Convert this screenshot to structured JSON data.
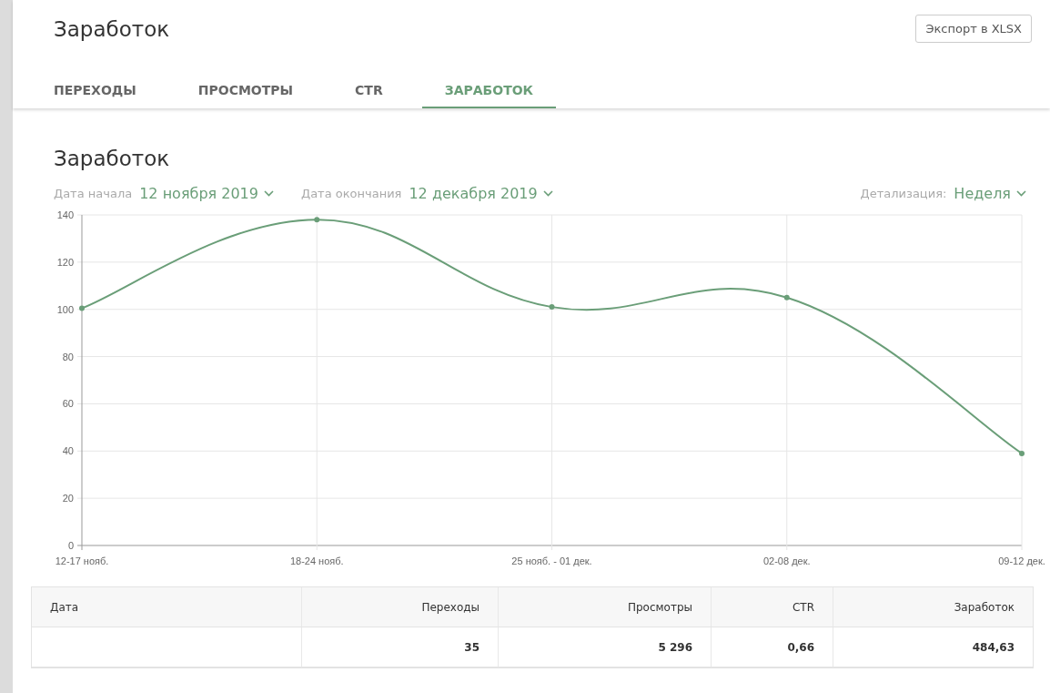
{
  "header": {
    "title": "Заработок",
    "export_button": "Экспорт в XLSX"
  },
  "tabs": [
    {
      "label": "ПЕРЕХОДЫ",
      "selected": false
    },
    {
      "label": "ПРОСМОТРЫ",
      "selected": false
    },
    {
      "label": "CTR",
      "selected": false
    },
    {
      "label": "ЗАРАБОТОК",
      "selected": true
    }
  ],
  "section": {
    "title": "Заработок",
    "filters": [
      {
        "label": "Дата начала",
        "value": "12 ноября 2019"
      },
      {
        "label": "Дата окончания",
        "value": "12 декабря 2019"
      }
    ],
    "detail": {
      "label": "Детализация:",
      "value": "Неделя"
    },
    "chart_data": {
      "type": "line",
      "grid": true,
      "categories": [
        "12-17 нояб.",
        "18-24 нояб.",
        "25 нояб. - 01 дек.",
        "02-08 дек.",
        "09-12 дек."
      ],
      "ylim": [
        0,
        140
      ],
      "yticks": [
        0,
        20,
        40,
        60,
        80,
        100,
        120,
        140
      ],
      "series": [
        {
          "color": "#6a9e78",
          "marker": true,
          "values": [
            100.5,
            138,
            101,
            105,
            39
          ]
        }
      ]
    }
  },
  "table": {
    "columns": [
      "Дата",
      "Переходы",
      "Просмотры",
      "CTR",
      "Заработок"
    ],
    "rows": [
      [
        "",
        "35",
        "5 296",
        "0,66",
        "484,63"
      ]
    ]
  }
}
